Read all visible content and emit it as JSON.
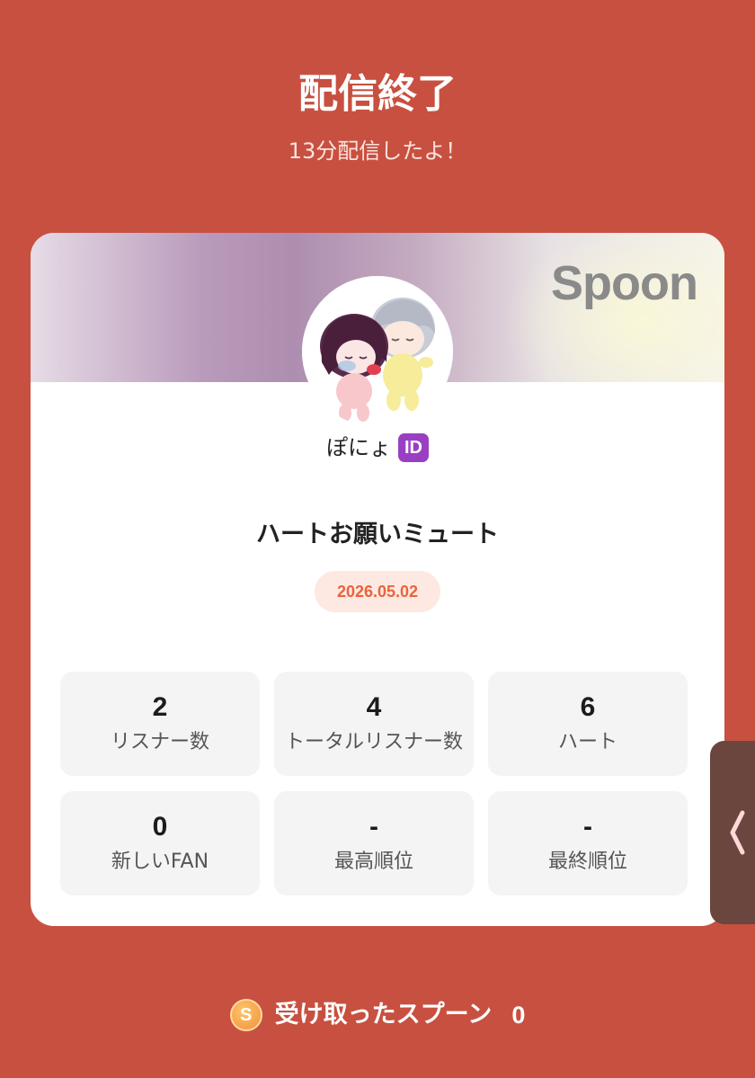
{
  "header": {
    "title": "配信終了",
    "subtitle": "13分配信したよ！"
  },
  "card": {
    "brand": "Spoon",
    "username": "ぽにょ",
    "id_badge": "ID",
    "show_title": "ハートお願いミュート",
    "date": "2026.05.02",
    "stats": [
      {
        "value": "2",
        "label": "リスナー数"
      },
      {
        "value": "4",
        "label": "トータルリスナー数"
      },
      {
        "value": "6",
        "label": "ハート"
      },
      {
        "value": "0",
        "label": "新しいFAN"
      },
      {
        "value": "-",
        "label": "最高順位"
      },
      {
        "value": "-",
        "label": "最終順位"
      }
    ]
  },
  "footer": {
    "coin_icon": "S",
    "label": "受け取ったスプーン",
    "value": "0"
  },
  "icons": {
    "side_tab": "chevron-left-icon",
    "coin": "spoon-coin-icon"
  },
  "colors": {
    "background": "#c85040",
    "date_text": "#e8643a",
    "id_badge": "#9a3fc4",
    "coin": "#f1913a"
  }
}
